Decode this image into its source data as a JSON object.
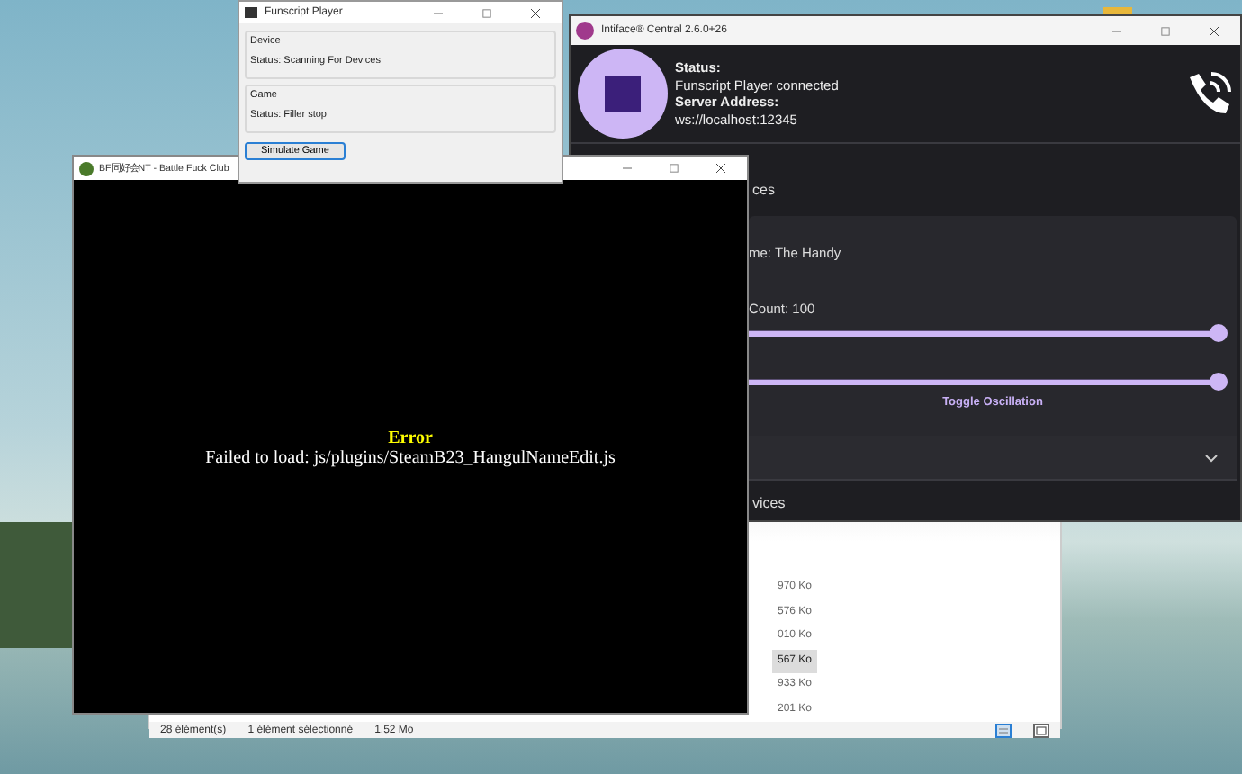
{
  "explorer_window": {
    "sizes": [
      {
        "text": "970 Ko",
        "selected": false
      },
      {
        "text": "576 Ko",
        "selected": false
      },
      {
        "text": "010 Ko",
        "selected": false
      },
      {
        "text": "567 Ko",
        "selected": true
      },
      {
        "text": "933 Ko",
        "selected": false
      },
      {
        "text": "201 Ko",
        "selected": false
      }
    ],
    "item_count": "28 élément(s)",
    "selection_info": "1 élément sélectionné",
    "selection_size": "1,52 Mo",
    "views": [
      {
        "kind": "details",
        "selected": true
      },
      {
        "kind": "tiles",
        "selected": false
      }
    ]
  },
  "intiface_window": {
    "title": "Intiface® Central 2.6.0+26",
    "status_label": "Status:",
    "status": "Funscript Player connected",
    "address_label": "Server Address:",
    "address": "ws://localhost:12345",
    "section_heading": "ces",
    "device_name": "me: The Handy",
    "count": "Count: 100",
    "sliders": [
      {
        "level": 1
      },
      {
        "level": 1
      }
    ],
    "toggle_button": "Toggle Oscillation",
    "footer_heading": "vices"
  },
  "game_window": {
    "title": "BF同好会NT - Battle Fuck Club",
    "error_title": "Error",
    "error_message": "Failed to load: js/plugins/SteamB23_HangulNameEdit.js"
  },
  "funscript_window": {
    "title": "Funscript Player",
    "groups": [
      {
        "label": "Device",
        "status": "Status: Scanning For Devices"
      },
      {
        "label": "Game",
        "status": "Status: Filler stop"
      }
    ],
    "button": "Simulate Game"
  }
}
